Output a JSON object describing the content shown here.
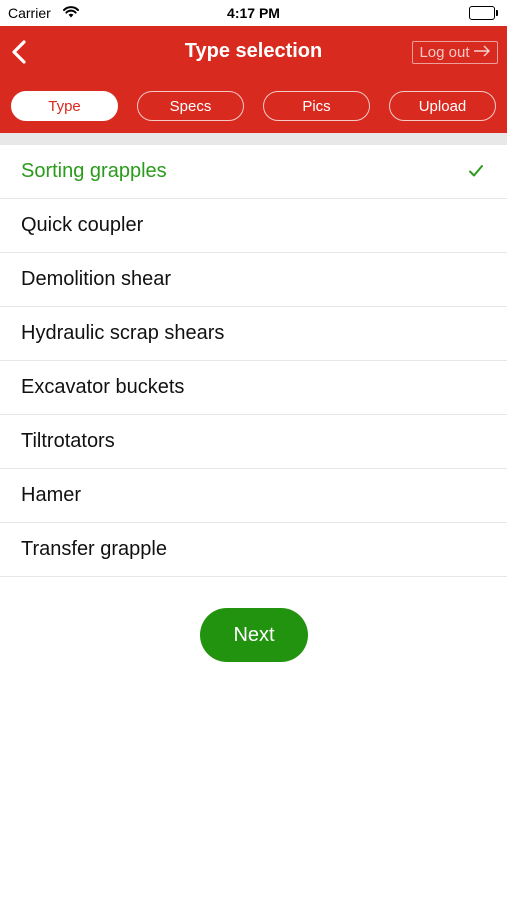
{
  "status_bar": {
    "carrier": "Carrier",
    "time": "4:17 PM"
  },
  "header": {
    "title": "Type selection",
    "logout_label": "Log out",
    "background_color": "#d92a20"
  },
  "tabs": [
    {
      "label": "Type",
      "active": true
    },
    {
      "label": "Specs",
      "active": false
    },
    {
      "label": "Pics",
      "active": false
    },
    {
      "label": "Upload",
      "active": false
    }
  ],
  "types": [
    {
      "label": "Sorting grapples",
      "selected": true
    },
    {
      "label": "Quick coupler",
      "selected": false
    },
    {
      "label": "Demolition shear",
      "selected": false
    },
    {
      "label": "Hydraulic scrap shears",
      "selected": false
    },
    {
      "label": "Excavator buckets",
      "selected": false
    },
    {
      "label": "Tiltrotators",
      "selected": false
    },
    {
      "label": "Hamer",
      "selected": false
    },
    {
      "label": "Transfer grapple",
      "selected": false
    }
  ],
  "next_button": {
    "label": "Next",
    "color": "#22930f"
  },
  "selected_color": "#2a9b1b"
}
